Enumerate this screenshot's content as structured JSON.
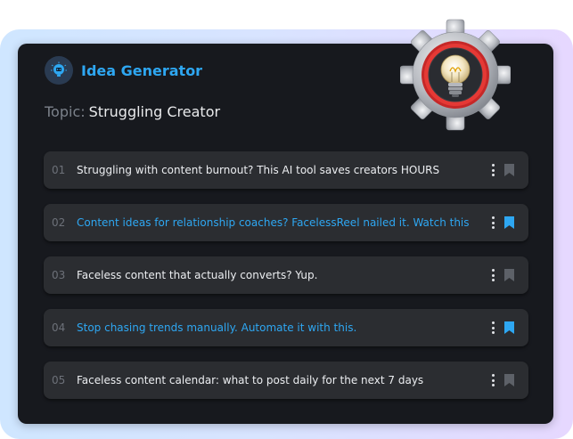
{
  "header": {
    "app_title": "Idea Generator",
    "logo_icon": "robot-bulb-icon"
  },
  "topic": {
    "label": "Topic:",
    "value": "Struggling Creator"
  },
  "ideas": [
    {
      "number": "01",
      "text": "Struggling with content burnout? This AI tool saves creators HOURS",
      "bookmarked": false
    },
    {
      "number": "02",
      "text": "Content ideas for relationship coaches? FacelessReel nailed it. Watch this.",
      "bookmarked": true
    },
    {
      "number": "03",
      "text": "Faceless content that actually converts? Yup.",
      "bookmarked": false
    },
    {
      "number": "04",
      "text": "Stop chasing trends manually. Automate it with this.",
      "bookmarked": true
    },
    {
      "number": "05",
      "text": "Faceless content calendar: what to post daily for the next 7 days",
      "bookmarked": false
    }
  ],
  "colors": {
    "accent": "#2ea7f2",
    "panel": "#17191e",
    "card": "#2b2d31",
    "bookmark_inactive": "#5d6168"
  }
}
